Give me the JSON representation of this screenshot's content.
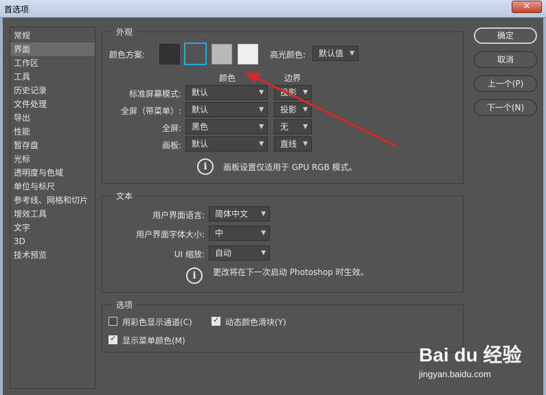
{
  "window": {
    "title": "首选项",
    "close_glyph": "✕"
  },
  "nav": {
    "items": [
      "常规",
      "界面",
      "工作区",
      "工具",
      "历史记录",
      "文件处理",
      "导出",
      "性能",
      "暂存盘",
      "光标",
      "透明度与色域",
      "单位与标尺",
      "参考线、网格和切片",
      "增效工具",
      "文字",
      "3D",
      "技术预览"
    ],
    "active_index": 1
  },
  "buttons": {
    "ok": "确定",
    "cancel": "取消",
    "prev": "上一个(P)",
    "next": "下一个(N)"
  },
  "appearance": {
    "title": "外观",
    "color_scheme_label": "颜色方案:",
    "swatches": [
      {
        "color": "#323232"
      },
      {
        "color": "#535353",
        "selected": true
      },
      {
        "color": "#b8b8b8"
      },
      {
        "color": "#f0f0f0"
      }
    ],
    "highlight_label": "高光颜色:",
    "highlight_value": "默认值",
    "col_color": "颜色",
    "col_border": "边界",
    "rows": [
      {
        "label": "标准屏幕模式:",
        "color": "默认",
        "border": "投影"
      },
      {
        "label": "全屏（带菜单）:",
        "color": "默认",
        "border": "投影"
      },
      {
        "label": "全屏:",
        "color": "黑色",
        "border": "无"
      },
      {
        "label": "画板:",
        "color": "默认",
        "border": "直线"
      }
    ],
    "note": "画板设置仅适用于 GPU RGB 模式。"
  },
  "text": {
    "title": "文本",
    "lang_label": "用户界面语言:",
    "lang_value": "简体中文",
    "font_size_label": "用户界面字体大小:",
    "font_size_value": "中",
    "scale_label": "UI 缩放:",
    "scale_value": "自动",
    "note": "更改将在下一次启动 Photoshop 时生效。"
  },
  "options": {
    "title": "选项",
    "color_channels": {
      "label": "用彩色显示通道(C)",
      "checked": false
    },
    "dynamic_sliders": {
      "label": "动态颜色滑块(Y)",
      "checked": true
    },
    "menu_colors": {
      "label": "显示菜单颜色(M)",
      "checked": true
    }
  },
  "annotation": {
    "arrow_color": "#d9262b"
  },
  "watermark": {
    "logo": "Bai du 经验",
    "site": "jingyan.baidu.com"
  }
}
